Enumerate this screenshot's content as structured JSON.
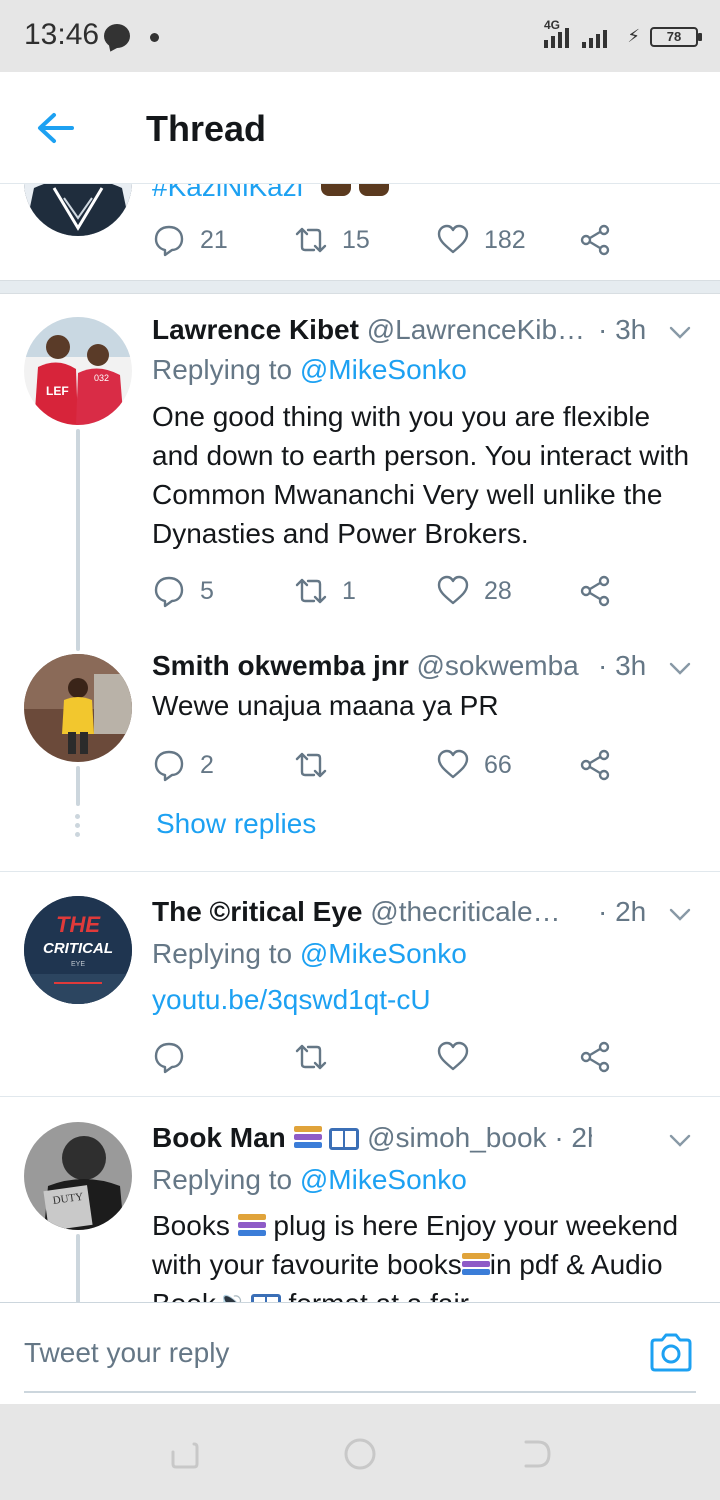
{
  "status_bar": {
    "time": "13:46",
    "network": "4G",
    "battery": "78"
  },
  "header": {
    "title": "Thread",
    "back_icon": "arrow-left-icon"
  },
  "partial_tweet": {
    "hashtag_text": "#KaziNiKazi",
    "replies": "21",
    "retweets": "15",
    "likes": "182"
  },
  "tweets": [
    {
      "name": "Lawrence Kibet",
      "handle": "@LawrenceKib…",
      "time": "· 3h",
      "replying_label": "Replying to",
      "replying_to": "@MikeSonko",
      "text": "One good  thing with you you are flexible and down to earth person. You interact with Common Mwananchi Very well unlike the Dynasties and Power Brokers.",
      "replies": "5",
      "retweets": "1",
      "likes": "28"
    },
    {
      "name": "Smith okwemba jnr",
      "handle": "@sokwemba",
      "time": "· 3h",
      "text": "Wewe unajua maana ya PR",
      "replies": "2",
      "retweets": "",
      "likes": "66",
      "show_replies": "Show replies"
    },
    {
      "name": "The ©ritical Eye",
      "handle": "@thecriticale…",
      "time": "· 2h",
      "replying_label": "Replying to",
      "replying_to": "@MikeSonko",
      "link": "youtu.be/3qswd1qt-cU",
      "avatar_text_top": "THE",
      "avatar_text_bottom": "CRITICAL",
      "avatar_text_eye": "EYE"
    },
    {
      "name": "Book Man",
      "handle": "@simoh_book",
      "time": "· 2h",
      "replying_label": "Replying to",
      "replying_to": "@MikeSonko",
      "text_part1": "Books",
      "text_part2": "plug is here Enjoy your weekend with your favourite books",
      "text_part3": "in pdf & Audio Book",
      "text_part4": "format at a fair",
      "avatar_text": "DUTY"
    }
  ],
  "reply_bar": {
    "placeholder": "Tweet your reply"
  },
  "colors": {
    "accent": "#1da1f2",
    "muted": "#657786",
    "text": "#14171a"
  }
}
